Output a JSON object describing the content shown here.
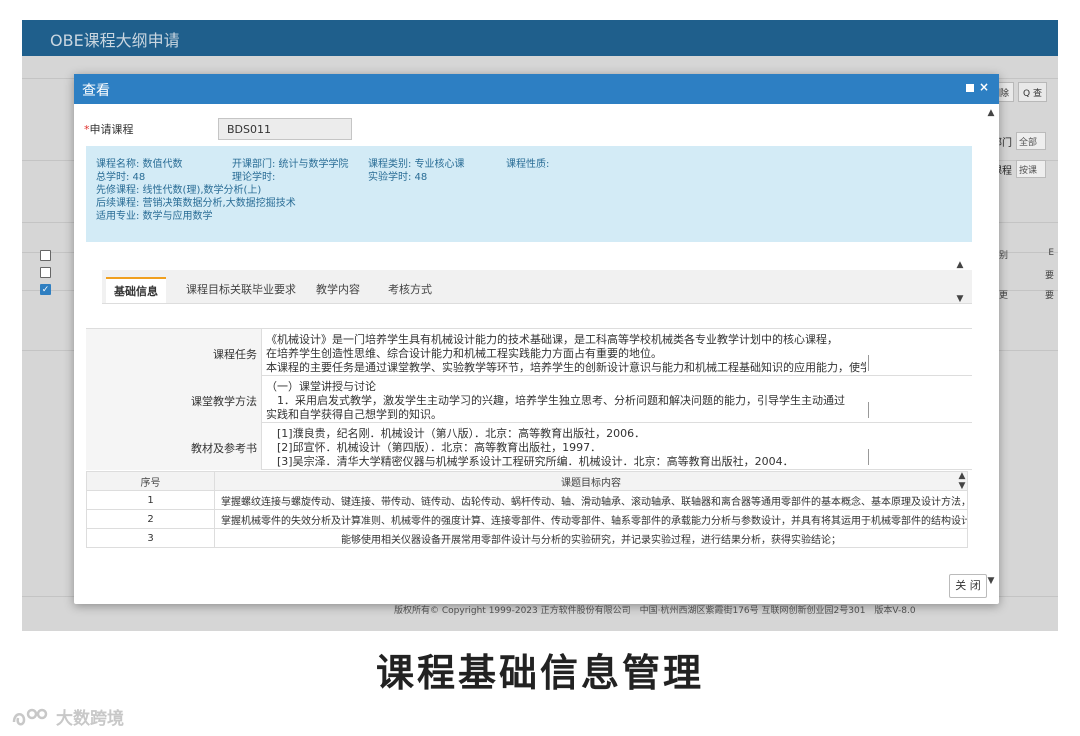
{
  "app": {
    "title": "OBE课程大纲申请",
    "toolbar": {
      "delete": "删除",
      "query": "Q 查"
    },
    "filters": [
      {
        "label": "部门",
        "value": "全部"
      },
      {
        "label": "课程",
        "value": "按课"
      }
    ],
    "right_col_texts": [
      "别",
      "E",
      "要",
      "更",
      "要"
    ],
    "footer": "版权所有© Copyright 1999-2023 正方软件股份有限公司　中国·杭州西湖区紫霞街176号 互联网创新创业园2号301　版本V-8.0"
  },
  "modal": {
    "title": "查看",
    "close_glyph": "×",
    "required_label": "申请课程",
    "required_star": "*",
    "course_code": "BDS011",
    "info": {
      "course_name": "课程名称: 数值代数",
      "department": "开课部门: 统计与数学学院",
      "category": "课程类别: 专业核心课",
      "nature": "课程性质:",
      "total_hours": "总学时: 48",
      "theory_hours": "理论学时:",
      "lab_hours": "实验学时: 48",
      "prerequisite": "先修课程: 线性代数(理),数学分析(上)",
      "followup": "后续课程: 营销决策数据分析,大数据挖掘技术",
      "major": "适用专业: 数学与应用数学"
    },
    "tabs": [
      "基础信息",
      "课程目标关联毕业要求",
      "教学内容",
      "考核方式"
    ],
    "details": [
      {
        "label": "课程任务",
        "lines": [
          "《机械设计》是一门培养学生具有机械设计能力的技术基础课，是工科高等学校机械类各专业教学计划中的核心课程，",
          "在培养学生创造性思维、综合设计能力和机械工程实践能力方面占有重要的地位。",
          "本课程的主要任务是通过课堂教学、实验教学等环节，培养学生的创新设计意识与能力和机械工程基础知识的应用能力，使学"
        ]
      },
      {
        "label": "课堂教学方法",
        "lines": [
          "（一）课堂讲授与讨论",
          "　1．采用启发式教学，激发学生主动学习的兴趣，培养学生独立思考、分析问题和解决问题的能力，引导学生主动通过",
          "实践和自学获得自己想学到的知识。"
        ]
      },
      {
        "label": "教材及参考书",
        "lines": [
          "　[1]濮良贵，纪名刚．机械设计（第八版）．北京：高等教育出版社，2006．",
          "　[2]邱宣怀．机械设计（第四版）．北京：高等教育出版社，1997．",
          "　[3]吴宗泽．清华大学精密仪器与机械学系设计工程研究所编．机械设计．北京：高等教育出版社，2004．"
        ]
      }
    ],
    "goals": {
      "headers": [
        "序号",
        "课题目标内容"
      ],
      "rows": [
        {
          "no": "1",
          "content": "掌握螺纹连接与螺旋传动、键连接、带传动、链传动、齿轮传动、蜗杆传动、轴、滑动轴承、滚动轴承、联轴器和离合器等通用零部件的基本概念、基本原理及设计方法，"
        },
        {
          "no": "2",
          "content": "掌握机械零件的失效分析及计算准则、机械零件的强度计算、连接零部件、传动零部件、轴系零部件的承载能力分析与参数设计，并具有将其运用于机械零部件的结构设计"
        },
        {
          "no": "3",
          "content": "能够使用相关仪器设备开展常用零部件设计与分析的实验研究，并记录实验过程，进行结果分析，获得实验结论；"
        }
      ]
    },
    "close_button": "关 闭"
  },
  "caption": "课程基础信息管理",
  "watermark": "大数跨境"
}
